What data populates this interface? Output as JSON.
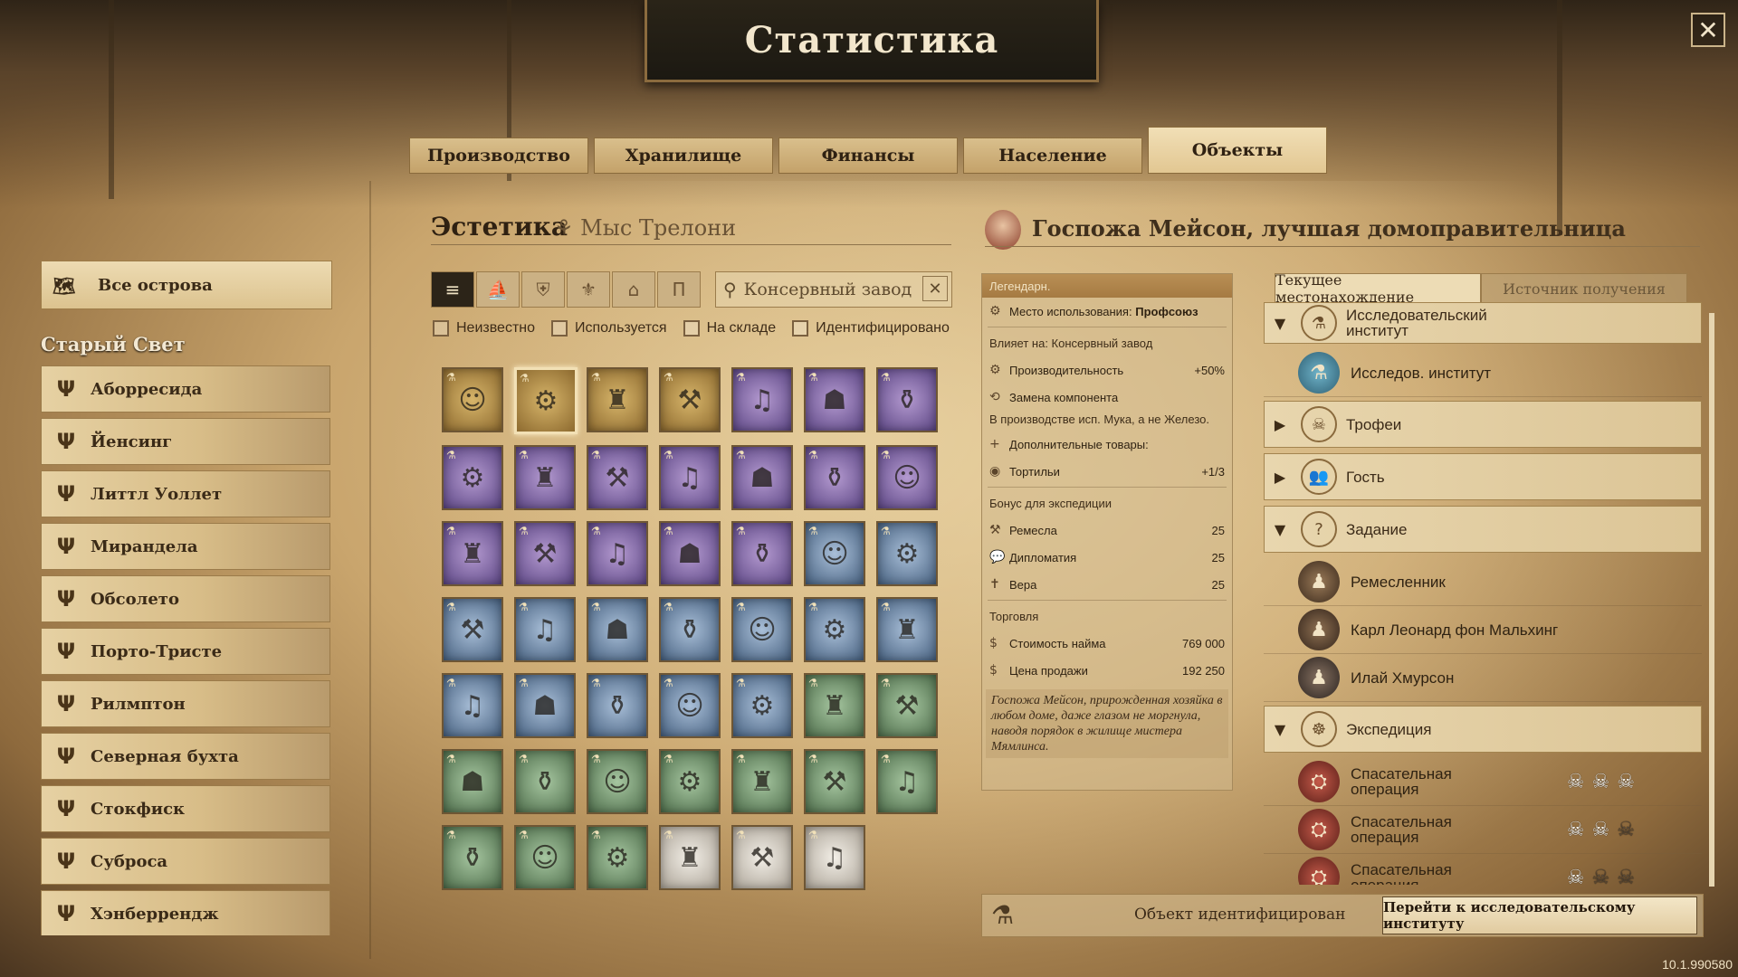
{
  "title": "Статистика",
  "tabs": [
    "Производство",
    "Хранилище",
    "Финансы",
    "Население",
    "Объекты"
  ],
  "left": {
    "all_islands": "Все острова",
    "region": "Старый Свет",
    "islands": [
      "Аборресида",
      "Йенсинг",
      "Литтл Уоллет",
      "Мирандела",
      "Обсолето",
      "Порто-Тристе",
      "Рилмптон",
      "Северная бухта",
      "Стокфиск",
      "Суброса",
      "Хэнберрендж"
    ]
  },
  "middle": {
    "section_title": "Эстетика",
    "section_sub": "Мыс Трелони",
    "search_value": "Консервный завод",
    "checkboxes": [
      "Неизвестно",
      "Используется",
      "На складе",
      "Идентифицировано"
    ]
  },
  "grid": [
    [
      "gold",
      "gold",
      "gold",
      "gold",
      "purple",
      "purple",
      "purple"
    ],
    [
      "purple",
      "purple",
      "purple",
      "purple",
      "purple",
      "purple",
      "purple"
    ],
    [
      "purple",
      "purple",
      "purple",
      "purple",
      "purple",
      "blue",
      "blue"
    ],
    [
      "blue",
      "blue",
      "blue",
      "blue",
      "blue",
      "blue",
      "blue"
    ],
    [
      "blue",
      "blue",
      "blue",
      "blue",
      "blue",
      "green",
      "green"
    ],
    [
      "green",
      "green",
      "green",
      "green",
      "green",
      "green",
      "green"
    ],
    [
      "green",
      "green",
      "green",
      "white",
      "white",
      "white"
    ]
  ],
  "detail": {
    "title": "Госпожа Мейсон, лучшая домоправительница",
    "rarity": "Легендарн.",
    "usage_label": "Место использования:",
    "usage_value": "Профсоюз",
    "affects": "Влияет на: Консервный завод",
    "productivity_label": "Производительность",
    "productivity_value": "+50%",
    "replace_label": "Замена компонента",
    "replace_text": "В производстве исп. Мука, а не Железо.",
    "extra_label": "Дополнительные товары:",
    "extra_item": "Тортильи",
    "extra_value": "+1/3",
    "expedition_label": "Бонус для экспедиции",
    "expedition": [
      {
        "label": "Ремесла",
        "value": "25"
      },
      {
        "label": "Дипломатия",
        "value": "25"
      },
      {
        "label": "Вера",
        "value": "25"
      }
    ],
    "trade_label": "Торговля",
    "hire_label": "Стоимость найма",
    "hire_value": "769 000",
    "sell_label": "Цена продажи",
    "sell_value": "192 250",
    "description": "Госпожа Мейсон, прирожденная хозяйка в любом доме, даже глазом не моргнула, наводя порядок в жилище мистера Мямлинса."
  },
  "bottom": {
    "status": "Объект идентифицирован",
    "goto": "Перейти к исследовательскому институту"
  },
  "right": {
    "tabs": [
      "Текущее местонахождение",
      "Источник получения"
    ],
    "groups": {
      "institute": "Исследовательский институт",
      "institute_item": "Исследов. институт",
      "trophies": "Трофеи",
      "guest": "Гость",
      "quest": "Задание",
      "quest_items": [
        "Ремесленник",
        "Карл Леонард фон Мальхинг",
        "Илай Хмурсон"
      ],
      "expedition": "Экспедиция",
      "expedition_items": [
        {
          "label": "Спасательная операция",
          "skulls": 3
        },
        {
          "label": "Спасательная операция",
          "skulls": 2
        },
        {
          "label": "Спасательная операция",
          "skulls": 1
        }
      ]
    }
  },
  "version": "10.1.990580"
}
